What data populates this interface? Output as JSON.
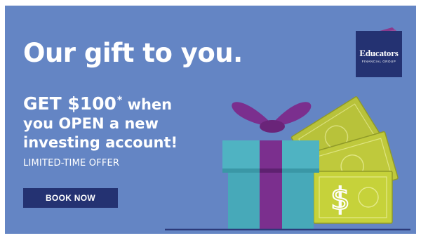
{
  "banner": {
    "headline": "Our gift to you.",
    "offer": {
      "line1_amount": "GET $100",
      "line1_asterisk": "*",
      "line1_rest": "when",
      "line2": "you OPEN a new",
      "line3": "investing account!"
    },
    "limited": "LIMITED-TIME OFFER",
    "cta_label": "BOOK NOW"
  },
  "logo": {
    "name": "Educators",
    "subtitle": "FINANCIAL GROUP"
  },
  "icons": {
    "gift": "gift-box-icon",
    "money": "dollar-bills-icon",
    "logo_mark": "book-tab-icon"
  },
  "colors": {
    "background": "#6485c4",
    "button": "#243272",
    "gift_box": "#47a9b9",
    "ribbon": "#7b2f8e",
    "bill": "#c6d23a",
    "logo_accent": "#8a3a8c"
  }
}
